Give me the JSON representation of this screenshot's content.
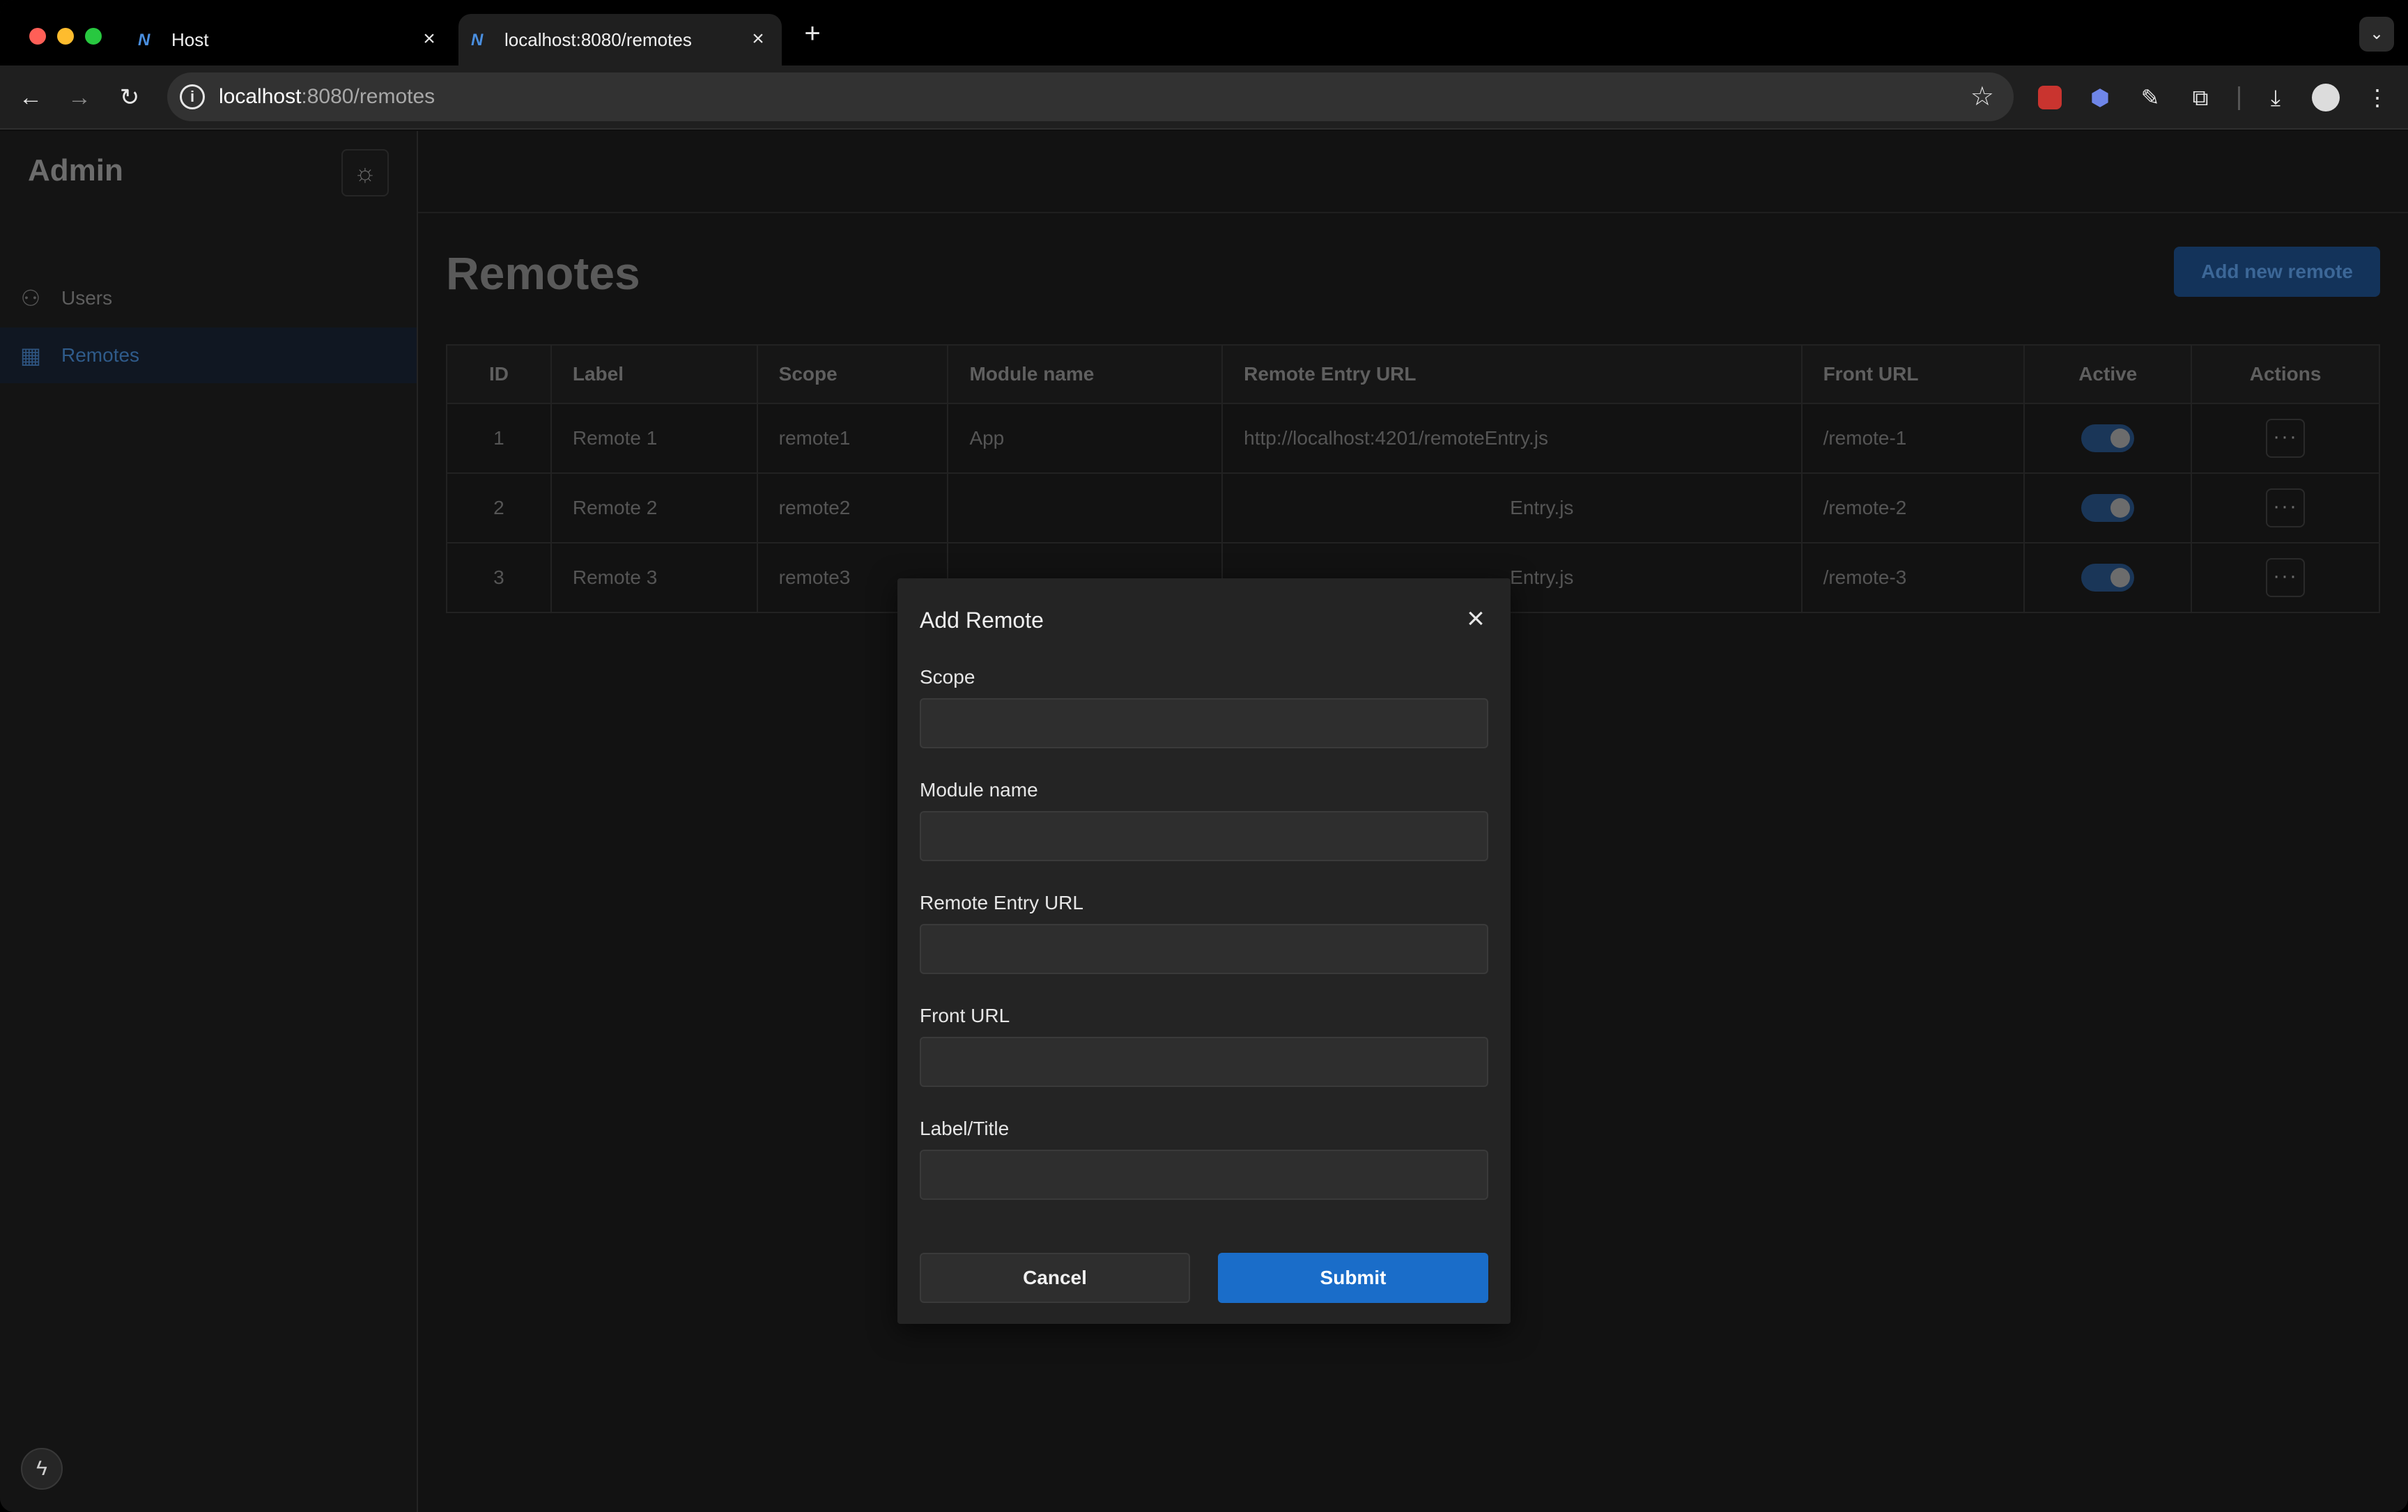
{
  "browser": {
    "tabs": [
      {
        "title": "Host",
        "favicon": "nx-logo-icon"
      },
      {
        "title": "localhost:8080/remotes",
        "favicon": "nx-logo-icon"
      }
    ],
    "url_host": "localhost",
    "url_path": ":8080/remotes"
  },
  "sidebar": {
    "brand": "Admin",
    "items": [
      {
        "label": "Users",
        "icon": "users-icon",
        "active": false
      },
      {
        "label": "Remotes",
        "icon": "table-icon",
        "active": true
      }
    ]
  },
  "main": {
    "title": "Remotes",
    "add_button": "Add new remote",
    "table": {
      "columns": [
        "ID",
        "Label",
        "Scope",
        "Module name",
        "Remote Entry URL",
        "Front URL",
        "Active",
        "Actions"
      ],
      "rows": [
        {
          "id": "1",
          "label": "Remote 1",
          "scope": "remote1",
          "module": "App",
          "entry": "http://localhost:4201/remoteEntry.js",
          "front": "/remote-1",
          "active": true
        },
        {
          "id": "2",
          "label": "Remote 2",
          "scope": "remote2",
          "module": "",
          "entry": "Entry.js",
          "front": "/remote-2",
          "active": true
        },
        {
          "id": "3",
          "label": "Remote 3",
          "scope": "remote3",
          "module": "",
          "entry": "Entry.js",
          "front": "/remote-3",
          "active": true
        }
      ]
    }
  },
  "modal": {
    "title": "Add Remote",
    "fields": [
      {
        "label": "Scope",
        "value": ""
      },
      {
        "label": "Module name",
        "value": ""
      },
      {
        "label": "Remote Entry URL",
        "value": ""
      },
      {
        "label": "Front URL",
        "value": ""
      },
      {
        "label": "Label/Title",
        "value": ""
      }
    ],
    "cancel": "Cancel",
    "submit": "Submit"
  },
  "colors": {
    "accent": "#1a6dc9",
    "toggle_on": "#1a3658",
    "background": "#121212"
  }
}
